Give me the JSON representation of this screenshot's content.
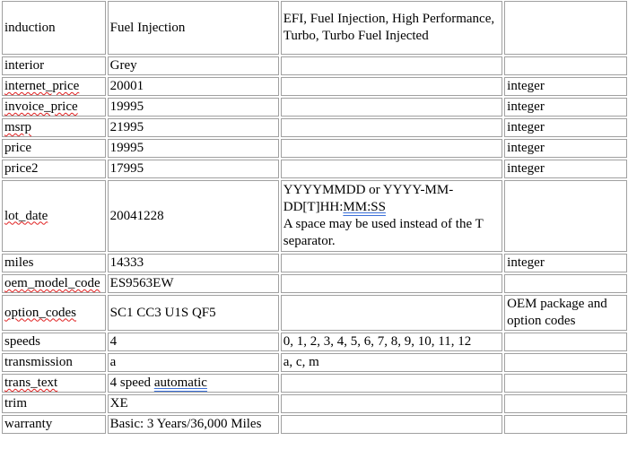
{
  "rows": [
    {
      "h": 60,
      "cells": [
        [
          {
            "t": "induction"
          }
        ],
        [
          {
            "t": "Fuel Injection"
          }
        ],
        [
          {
            "t": "EFI, Fuel Injection, High Performance, Turbo, Turbo Fuel Injected"
          }
        ],
        []
      ]
    },
    {
      "h": 21,
      "cells": [
        [
          {
            "t": "interior"
          }
        ],
        [
          {
            "t": "Grey"
          }
        ],
        [],
        []
      ]
    },
    {
      "h": 21,
      "cells": [
        [
          {
            "t": "internet_price",
            "u": "spell"
          }
        ],
        [
          {
            "t": "20001"
          }
        ],
        [],
        [
          {
            "t": "integer"
          }
        ]
      ]
    },
    {
      "h": 21,
      "cells": [
        [
          {
            "t": "invoice_price",
            "u": "spell"
          }
        ],
        [
          {
            "t": "19995"
          }
        ],
        [],
        [
          {
            "t": "integer"
          }
        ]
      ]
    },
    {
      "h": 21,
      "cells": [
        [
          {
            "t": "msrp",
            "u": "spell"
          }
        ],
        [
          {
            "t": "21995"
          }
        ],
        [],
        [
          {
            "t": "integer"
          }
        ]
      ]
    },
    {
      "h": 21,
      "cells": [
        [
          {
            "t": "price"
          }
        ],
        [
          {
            "t": "19995"
          }
        ],
        [],
        [
          {
            "t": "integer"
          }
        ]
      ]
    },
    {
      "h": 21,
      "cells": [
        [
          {
            "t": "price2"
          }
        ],
        [
          {
            "t": "17995"
          }
        ],
        [],
        [
          {
            "t": "integer"
          }
        ]
      ]
    },
    {
      "h": 80,
      "cells": [
        [
          {
            "t": "lot_date",
            "u": "spell"
          }
        ],
        [
          {
            "t": "20041228"
          }
        ],
        [
          {
            "t": "YYYYMMDD or YYYY-MM-DD[T]HH:"
          },
          {
            "t": "MM:SS",
            "u": "grammar"
          },
          {
            "t": " A space may be used instead of the T separator.",
            "br": true
          }
        ],
        []
      ]
    },
    {
      "h": 20,
      "cells": [
        [
          {
            "t": "miles"
          }
        ],
        [
          {
            "t": "14333"
          }
        ],
        [],
        [
          {
            "t": "integer"
          }
        ]
      ]
    },
    {
      "h": 20,
      "cells": [
        [
          {
            "t": "oem_model_code",
            "u": "spell"
          }
        ],
        [
          {
            "t": "ES9563EW"
          }
        ],
        [],
        []
      ]
    },
    {
      "h": 40,
      "cells": [
        [
          {
            "t": "option_codes",
            "u": "spell"
          }
        ],
        [
          {
            "t": "SC1 CC3 U1S QF5"
          }
        ],
        [],
        [
          {
            "t": "OEM package and option codes"
          }
        ]
      ]
    },
    {
      "h": 21,
      "cells": [
        [
          {
            "t": "speeds"
          }
        ],
        [
          {
            "t": "4"
          }
        ],
        [
          {
            "t": "0, 1, 2, 3, 4, 5, 6, 7, 8, 9, 10, 11, 12"
          }
        ],
        []
      ]
    },
    {
      "h": 21,
      "cells": [
        [
          {
            "t": "transmission"
          }
        ],
        [
          {
            "t": "a"
          }
        ],
        [
          {
            "t": "a, c, m"
          }
        ],
        []
      ]
    },
    {
      "h": 21,
      "cells": [
        [
          {
            "t": "trans_text",
            "u": "spell"
          }
        ],
        [
          {
            "t": "4 speed "
          },
          {
            "t": "automatic",
            "u": "grammar"
          }
        ],
        [],
        []
      ]
    },
    {
      "h": 21,
      "cells": [
        [
          {
            "t": "trim"
          }
        ],
        [
          {
            "t": "XE"
          }
        ],
        [],
        []
      ]
    },
    {
      "h": 21,
      "cells": [
        [
          {
            "t": "warranty"
          }
        ],
        [
          {
            "t": "Basic: 3 Years/36,000 Miles"
          }
        ],
        [],
        []
      ]
    }
  ]
}
